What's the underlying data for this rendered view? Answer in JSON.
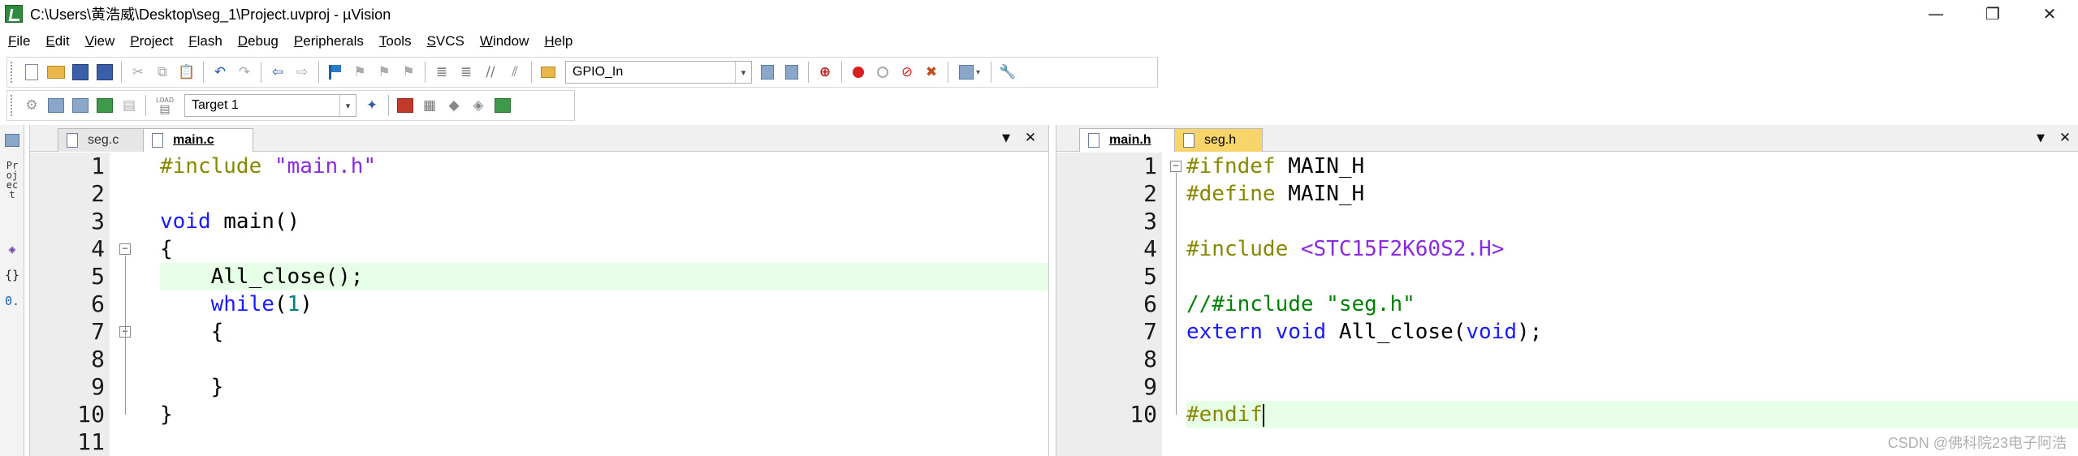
{
  "window": {
    "title": "C:\\Users\\黄浩威\\Desktop\\seg_1\\Project.uvproj - µVision",
    "minimize_glyph": "—",
    "restore_glyph": "❐",
    "close_glyph": "✕"
  },
  "menu": [
    {
      "label": "File",
      "ul": "F",
      "rest": "ile"
    },
    {
      "label": "Edit",
      "ul": "E",
      "rest": "dit"
    },
    {
      "label": "View",
      "ul": "V",
      "rest": "iew"
    },
    {
      "label": "Project",
      "ul": "P",
      "rest": "roject"
    },
    {
      "label": "Flash",
      "ul": "F",
      "rest": "lash"
    },
    {
      "label": "Debug",
      "ul": "D",
      "rest": "ebug"
    },
    {
      "label": "Peripherals",
      "ul": "P",
      "rest": "eripherals"
    },
    {
      "label": "Tools",
      "ul": "T",
      "rest": "ools"
    },
    {
      "label": "SVCS",
      "ul": "S",
      "rest": "VCS"
    },
    {
      "label": "Window",
      "ul": "W",
      "rest": "indow"
    },
    {
      "label": "Help",
      "ul": "H",
      "rest": "elp"
    }
  ],
  "toolbar": {
    "find_combo_value": "GPIO_In",
    "target_combo_value": "Target 1",
    "load_label": "LOAD"
  },
  "side": {
    "project_label": "Project",
    "braces_glyph": "{}",
    "func_glyph": "0."
  },
  "left_pane": {
    "tabs": [
      {
        "label": "seg.c",
        "active": false
      },
      {
        "label": "main.c",
        "active": true
      }
    ],
    "menu_glyph": "▼",
    "close_glyph": "✕",
    "lines": [
      {
        "num": "1",
        "tokens": [
          [
            "pre",
            "#include "
          ],
          [
            "str",
            "\"main.h\""
          ]
        ]
      },
      {
        "num": "2",
        "tokens": []
      },
      {
        "num": "3",
        "tokens": [
          [
            "kw",
            "void"
          ],
          [
            "txt",
            " main()"
          ]
        ]
      },
      {
        "num": "4",
        "tokens": [
          [
            "txt",
            "{"
          ]
        ],
        "fold": "−"
      },
      {
        "num": "5",
        "tokens": [
          [
            "txt",
            "    All_close();"
          ]
        ],
        "highlight": true
      },
      {
        "num": "6",
        "tokens": [
          [
            "txt",
            "    "
          ],
          [
            "kw",
            "while"
          ],
          [
            "txt",
            "("
          ],
          [
            "num",
            "1"
          ],
          [
            "txt",
            ")"
          ]
        ]
      },
      {
        "num": "7",
        "tokens": [
          [
            "txt",
            "    {"
          ]
        ],
        "fold": "−"
      },
      {
        "num": "8",
        "tokens": []
      },
      {
        "num": "9",
        "tokens": [
          [
            "txt",
            "    }"
          ]
        ]
      },
      {
        "num": "10",
        "tokens": [
          [
            "txt",
            "}"
          ]
        ]
      },
      {
        "num": "11",
        "tokens": []
      }
    ]
  },
  "right_pane": {
    "tabs": [
      {
        "label": "main.h",
        "active": true
      },
      {
        "label": "seg.h",
        "active": false
      }
    ],
    "menu_glyph": "▼",
    "close_glyph": "✕",
    "lines": [
      {
        "num": "1",
        "tokens": [
          [
            "pre",
            "#ifndef"
          ],
          [
            "txt",
            " MAIN_H"
          ]
        ],
        "fold": "−"
      },
      {
        "num": "2",
        "tokens": [
          [
            "pre",
            "#define"
          ],
          [
            "txt",
            " MAIN_H"
          ]
        ]
      },
      {
        "num": "3",
        "tokens": []
      },
      {
        "num": "4",
        "tokens": [
          [
            "pre",
            "#include "
          ],
          [
            "str",
            "<STC15F2K60S2.H>"
          ]
        ]
      },
      {
        "num": "5",
        "tokens": []
      },
      {
        "num": "6",
        "tokens": [
          [
            "cmt",
            "//#include \"seg.h\""
          ]
        ]
      },
      {
        "num": "7",
        "tokens": [
          [
            "kw",
            "extern"
          ],
          [
            "txt",
            " "
          ],
          [
            "kw",
            "void"
          ],
          [
            "txt",
            " All_close("
          ],
          [
            "kw",
            "void"
          ],
          [
            "txt",
            ");"
          ]
        ]
      },
      {
        "num": "8",
        "tokens": []
      },
      {
        "num": "9",
        "tokens": []
      },
      {
        "num": "10",
        "tokens": [
          [
            "pre",
            "#endif"
          ]
        ],
        "highlight": true,
        "caret": true
      }
    ]
  },
  "watermark": "CSDN @佛科院23电子阿浩"
}
